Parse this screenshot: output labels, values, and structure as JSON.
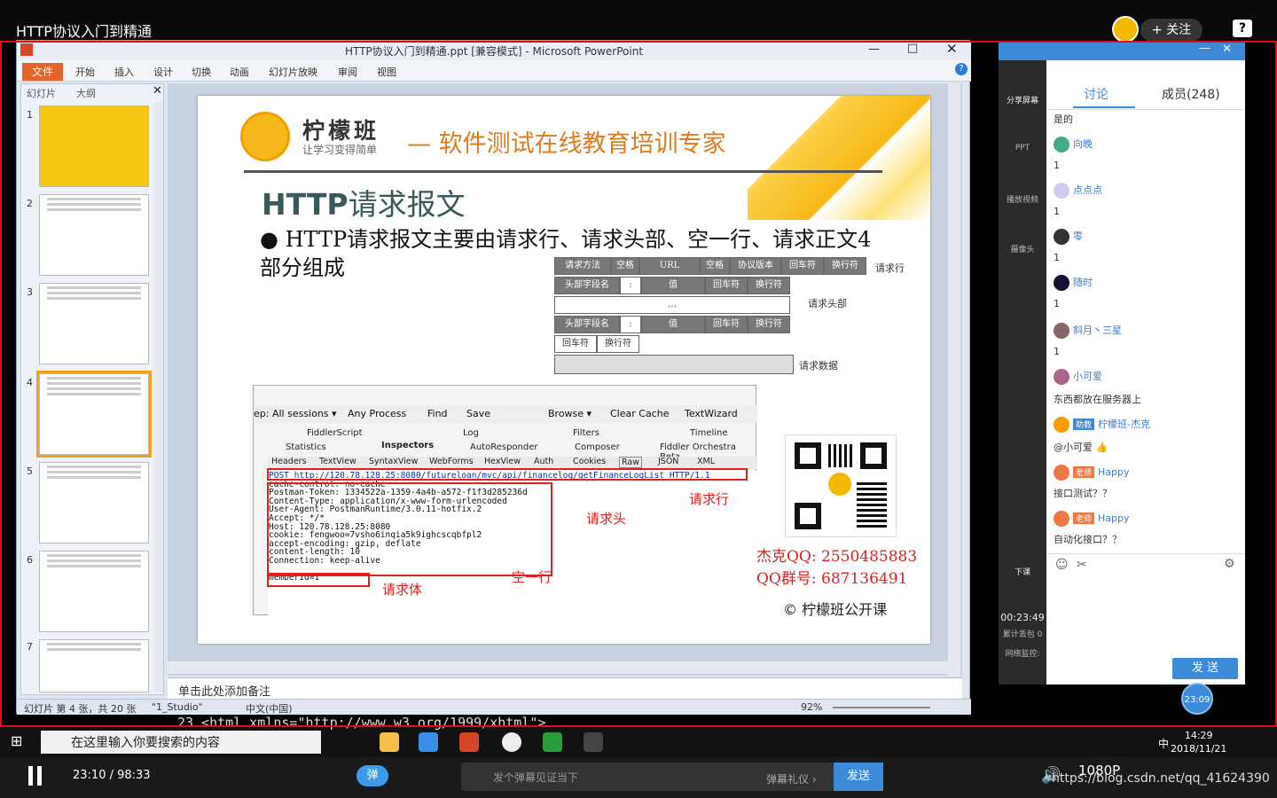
{
  "video": {
    "title": "HTTP协议入门到精通",
    "follow": "+ 关注",
    "help": "?"
  },
  "ppt": {
    "window_title": "HTTP协议入门到精通.ppt [兼容模式] - Microsoft PowerPoint",
    "file_tab": "文件",
    "tabs": [
      "开始",
      "插入",
      "设计",
      "切换",
      "动画",
      "幻灯片放映",
      "审阅",
      "视图"
    ],
    "side_tabs": [
      "幻灯片",
      "大纲"
    ],
    "thumb_numbers": [
      "1",
      "2",
      "3",
      "4",
      "5",
      "6",
      "7"
    ],
    "notes": "单击此处添加备注",
    "status": {
      "slide": "幻灯片 第 4 张，共 20 张",
      "theme": "\"1_Studio\"",
      "lang": "中文(中国)",
      "zoom": "92%"
    }
  },
  "slide": {
    "brand": "柠檬班",
    "brand_sub": "让学习变得简单",
    "tagline": "— 软件测试在线教育培训专家",
    "title_en": "HTTP",
    "title_cn": "请求报文",
    "bullet": "HTTP请求报文主要由请求行、请求头部、空一行、请求正文4部分组成",
    "table": {
      "row1": [
        "请求方法",
        "空格",
        "URL",
        "空格",
        "协议版本",
        "回车符",
        "换行符"
      ],
      "row1_label": "请求行",
      "row2": [
        "头部字段名",
        ":",
        "值",
        "回车符",
        "换行符"
      ],
      "dots": "…",
      "row3": [
        "头部字段名",
        ":",
        "值",
        "回车符",
        "换行符"
      ],
      "row4": [
        "回车符",
        "换行符"
      ],
      "header_label": "请求头部",
      "data_label": "请求数据"
    },
    "fiddler": {
      "toolbar": [
        "ep: All sessions ▾",
        "Any Process",
        "Find",
        "Save",
        "Browse ▾",
        "Clear Cache",
        "TextWizard"
      ],
      "tabs1": [
        "FiddlerScript",
        "Log",
        "Filters",
        "Timeline"
      ],
      "tabs2": [
        "Statistics",
        "Inspectors",
        "AutoResponder",
        "Composer",
        "Fiddler Orchestra Beta"
      ],
      "tabs3": [
        "Headers",
        "TextView",
        "SyntaxView",
        "WebForms",
        "HexView",
        "Auth",
        "Cookies",
        "Raw",
        "JSON",
        "XML"
      ],
      "lines": [
        "POST http://120.78.128.25:8080/futureloan/mvc/api/financelog/getFinanceLogList HTTP/1.1",
        "cache-control: no-cache",
        "Postman-Token: 1334522a-1359-4a4b-a572-f1f3d285236d",
        "Content-Type: application/x-www-form-urlencoded",
        "User-Agent: PostmanRuntime/3.0.11-hotfix.2",
        "Accept: */*",
        "Host: 120.78.128.25:8080",
        "cookie: fengwoo=7vsho6inqia5k9ighcscqbfpl2",
        "accept-encoding: gzip, deflate",
        "content-length: 10",
        "Connection: keep-alive",
        "",
        "memberId=1"
      ]
    },
    "labels": {
      "request_line": "请求行",
      "request_header": "请求头",
      "empty_line": "空一行",
      "request_body": "请求体"
    },
    "contact": {
      "qq": "杰克QQ: 2550485883",
      "group": "QQ群号: 687136491"
    },
    "copyright": "© 柠檬班公开课"
  },
  "chat": {
    "tabs": {
      "discuss": "讨论",
      "members": "成员(248)"
    },
    "left_buttons": [
      "分享屏幕",
      "PPT",
      "播放视频",
      "摄像头",
      "下课"
    ],
    "elapsed": "00:23:49",
    "lost": "累计丢包 0",
    "net": "网络监控:",
    "messages": [
      {
        "text": "是的"
      },
      {
        "user": "向晚"
      },
      {
        "text": "1"
      },
      {
        "user": "点点点"
      },
      {
        "text": "1"
      },
      {
        "user": "零"
      },
      {
        "text": "1"
      },
      {
        "user": "随时"
      },
      {
        "text": "1"
      },
      {
        "user": "斜月丶三星"
      },
      {
        "text": "1"
      },
      {
        "user": "小可爱"
      },
      {
        "text": "东西都放在服务器上"
      },
      {
        "user": "柠檬班-杰克",
        "role": "助教"
      },
      {
        "text": "@小可爱 👍"
      },
      {
        "user": "Happy",
        "role": "老师"
      },
      {
        "text": "接口测试？？"
      },
      {
        "user": "Happy",
        "role": "老师"
      },
      {
        "text": "自动化接口？？"
      }
    ],
    "send": "发 送",
    "time_badge": "23:09"
  },
  "taskbar": {
    "search": "在这里输入你要搜索的内容",
    "time": "14:29",
    "date": "2018/11/21",
    "ime": "中",
    "code": "23  <html xmlns=\"http://www.w3.org/1999/xhtml\">"
  },
  "player": {
    "time": "23:10 / 98:33",
    "danmu_btn": "弹",
    "danmu_placeholder": "发个弹幕见证当下",
    "gift": "弹幕礼仪 ›",
    "send": "发送",
    "resolution": "1080P",
    "url": "https://blog.csdn.net/qq_41624390"
  }
}
